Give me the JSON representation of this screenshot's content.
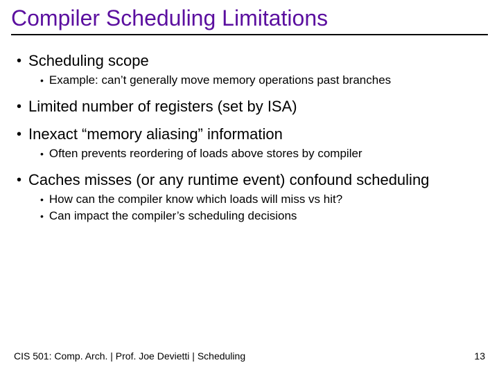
{
  "title": "Compiler Scheduling Limitations",
  "bullets": [
    {
      "text": "Scheduling scope",
      "sub": [
        "Example: can’t generally move memory operations past branches"
      ]
    },
    {
      "text": "Limited number of registers (set by ISA)",
      "sub": []
    },
    {
      "text": "Inexact “memory aliasing” information",
      "sub": [
        "Often prevents reordering of loads above stores by compiler"
      ]
    },
    {
      "text": "Caches misses (or any runtime event) confound scheduling",
      "sub": [
        "How can the compiler know which loads will miss vs hit?",
        "Can impact the compiler’s scheduling decisions"
      ]
    }
  ],
  "footer_left": "CIS 501: Comp. Arch.  |  Prof. Joe Devietti  |  Scheduling",
  "footer_right": "13"
}
